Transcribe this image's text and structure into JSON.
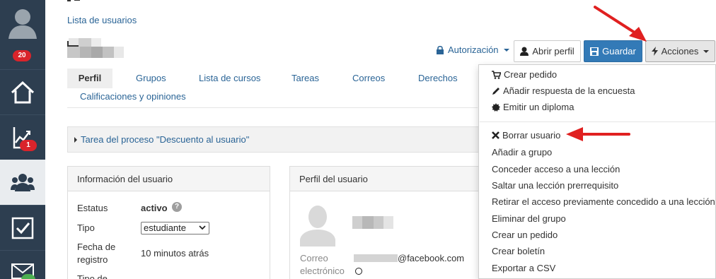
{
  "sidebar": {
    "badges": {
      "avatar": "20",
      "reports": "1",
      "mail": ""
    },
    "icons": [
      "user-avatar-icon",
      "home-icon",
      "chart-icon",
      "users-icon",
      "checkbox-icon",
      "mail-icon"
    ]
  },
  "breadcrumb": "Lista de usuarios",
  "toolbar": {
    "authorization": "Autorización",
    "open_profile": "Abrir perfil",
    "save": "Guardar",
    "actions": "Acciones"
  },
  "tabs": {
    "profile": "Perfil",
    "groups": "Grupos",
    "courses": "Lista de cursos",
    "tasks": "Tareas",
    "mails": "Correos",
    "rights": "Derechos",
    "ratings": "Calificaciones y opiniones"
  },
  "process": "Tarea del proceso \"Descuento al usuario\"",
  "info_panel": {
    "title": "Información del usuario",
    "status_label": "Estatus",
    "status_value": "activo",
    "help": "?",
    "type_label": "Tipo",
    "type_value": "estudiante",
    "registered_label": "Fecha de registro",
    "registered_value": "10 minutos atrás",
    "type2_label": "Tipo de"
  },
  "profile_panel": {
    "title": "Perfil del usuario",
    "email_label": "Correo electrónico",
    "email_value": "@facebook.com"
  },
  "actions_menu": {
    "create_order": "Crear pedido",
    "add_survey_answer": "Añadir respuesta de la encuesta",
    "issue_diploma": "Emitir un diploma",
    "delete_user": "Borrar usuario",
    "add_to_group": "Añadir a grupo",
    "grant_lesson": "Conceder acceso a una lección",
    "skip_prereq": "Saltar una lección prerrequisito",
    "revoke_access": "Retirar el acceso previamente concedido a una lección",
    "remove_group": "Eliminar del grupo",
    "create_an_order": "Crear un pedido",
    "create_newsletter": "Crear boletín",
    "export_csv": "Exportar a CSV"
  },
  "colors": {
    "sidebar": "#2d3e50",
    "link": "#2a6496",
    "primary": "#337ab7",
    "badge": "#d9242b",
    "annotation_arrow": "#e02020"
  }
}
